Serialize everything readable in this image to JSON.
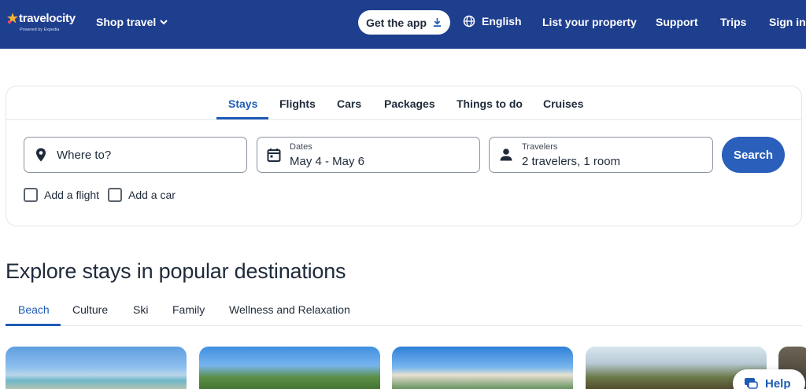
{
  "header": {
    "logo_text": "travelocity",
    "logo_powered": "Powered by Expedia",
    "shop_travel": "Shop travel",
    "get_app": "Get the app",
    "language": "English",
    "list_property": "List your property",
    "support": "Support",
    "trips": "Trips",
    "sign_in": "Sign in"
  },
  "search": {
    "tabs": [
      "Stays",
      "Flights",
      "Cars",
      "Packages",
      "Things to do",
      "Cruises"
    ],
    "active_tab": "Stays",
    "where_placeholder": "Where to?",
    "dates_label": "Dates",
    "dates_value": "May 4 - May 6",
    "travelers_label": "Travelers",
    "travelers_value": "2 travelers, 1 room",
    "search_button": "Search",
    "add_flight": "Add a flight",
    "add_car": "Add a car"
  },
  "explore": {
    "title": "Explore stays in popular destinations",
    "tabs": [
      "Beach",
      "Culture",
      "Ski",
      "Family",
      "Wellness and Relaxation"
    ],
    "active_tab": "Beach"
  },
  "help": {
    "label": "Help"
  },
  "colors": {
    "header_bg": "#1e3e8e",
    "accent": "#1e5bb5",
    "button_bg": "#2a5fbb"
  }
}
